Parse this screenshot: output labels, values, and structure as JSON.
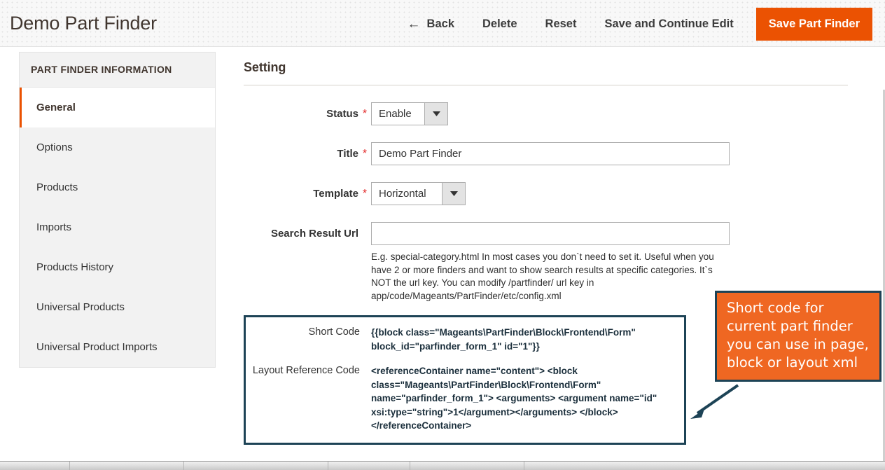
{
  "header": {
    "title": "Demo Part Finder",
    "back_label": "Back",
    "back_icon": "arrow-left-icon",
    "delete_label": "Delete",
    "reset_label": "Reset",
    "save_continue_label": "Save and Continue Edit",
    "save_label": "Save Part Finder",
    "primary_color": "#eb5202"
  },
  "sidebar": {
    "heading": "PART FINDER INFORMATION",
    "items": [
      {
        "label": "General",
        "active": true
      },
      {
        "label": "Options",
        "active": false
      },
      {
        "label": "Products",
        "active": false
      },
      {
        "label": "Imports",
        "active": false
      },
      {
        "label": "Products History",
        "active": false
      },
      {
        "label": "Universal Products",
        "active": false
      },
      {
        "label": "Universal Product Imports",
        "active": false
      }
    ],
    "active_indicator_color": "#eb5202"
  },
  "main": {
    "section_title": "Setting",
    "required_marker": "*",
    "fields": {
      "status": {
        "label": "Status",
        "value": "Enable",
        "required": true,
        "control": "select",
        "arrow_icon": "chevron-down-icon"
      },
      "title": {
        "label": "Title",
        "value": "Demo Part Finder",
        "placeholder": "",
        "required": true,
        "control": "text"
      },
      "template": {
        "label": "Template",
        "value": "Horizontal",
        "required": true,
        "control": "select",
        "arrow_icon": "chevron-down-icon"
      },
      "search_result_url": {
        "label": "Search Result Url",
        "value": "",
        "placeholder": "",
        "required": false,
        "control": "text",
        "note": "E.g. special-category.html In most cases you don`t need to set it. Useful when you have 2 or more finders and want to show search results at specific categories. It`s NOT the url key. You can modify /partfinder/ url key in app/code/Mageants/PartFinder/etc/config.xml"
      }
    },
    "shortcode": {
      "short_code_label": "Short Code",
      "short_code_value": "{{block class=\"Mageants\\PartFinder\\Block\\Frontend\\Form\" block_id=\"parfinder_form_1\" id=\"1\"}}",
      "layout_reference_label": "Layout Reference Code",
      "layout_reference_value": "<referenceContainer name=\"content\"> <block class=\"Mageants\\PartFinder\\Block\\Frontend\\Form\" name=\"parfinder_form_1\"> <arguments> <argument name=\"id\" xsi:type=\"string\">1</argument></arguments> </block> </referenceContainer>",
      "border_color": "#1d4356"
    }
  },
  "annotation": {
    "text": "Short code for current  part finder you can use in page, block or layout xml",
    "background_color": "#ef6722",
    "border_color": "#1d4356",
    "arrow_icon": "arrow-down-left-icon"
  }
}
